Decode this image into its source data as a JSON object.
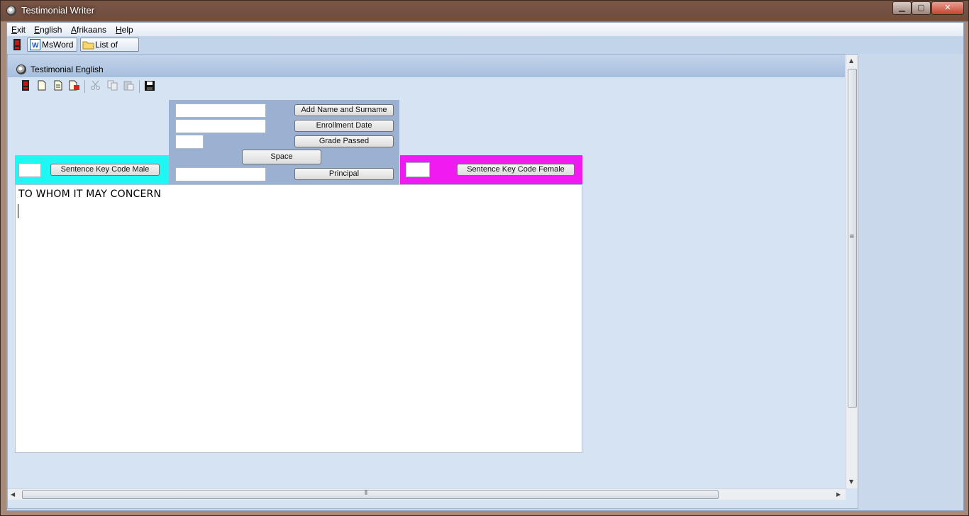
{
  "window": {
    "title": "Testimonial Writer",
    "controls": {
      "minimize": "▁",
      "maximize": "▢",
      "close": "✕"
    }
  },
  "menubar": {
    "items": [
      {
        "label": "Exit",
        "accel": "E"
      },
      {
        "label": "English",
        "accel": "E"
      },
      {
        "label": "Afrikaans",
        "accel": "A"
      },
      {
        "label": "Help",
        "accel": "H"
      }
    ]
  },
  "toolbar": {
    "msword_label": "MsWord",
    "list_docs_label": "List of Doc's"
  },
  "child": {
    "title": "Testimonial English",
    "icons": [
      "exit-icon",
      "new-document-icon",
      "open-document-icon",
      "print-icon",
      "cut-icon",
      "copy-icon",
      "paste-icon",
      "save-icon"
    ]
  },
  "form": {
    "add_name_label": "Add Name and Surname",
    "enrollment_label": "Enrollment Date",
    "grade_label": "Grade Passed",
    "space_label": "Space",
    "principal_label": "Principal",
    "male_label": "Sentence Key Code Male",
    "female_label": "Sentence Key Code Female"
  },
  "editor": {
    "text": "TO WHOM IT MAY CONCERN"
  },
  "colors": {
    "male_panel": "#1ff7f2",
    "female_panel": "#f11af1",
    "middle_panel": "#9bb1d1"
  }
}
